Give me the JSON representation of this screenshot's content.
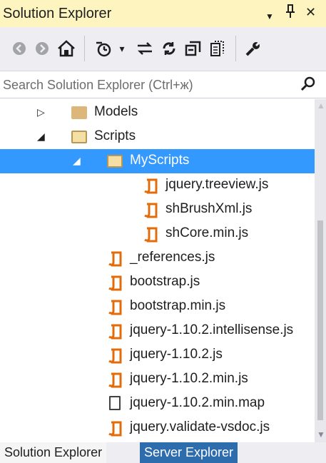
{
  "window": {
    "title": "Solution Explorer",
    "dropdown_glyph": "▼",
    "pin_glyph": "ᵖ",
    "close_glyph": "✕"
  },
  "toolbar": {
    "items": [
      {
        "name": "back-button",
        "icon": "back-circle-icon",
        "glyph": "◐",
        "disabled": true
      },
      {
        "name": "forward-button",
        "icon": "forward-circle-icon",
        "glyph": "◑",
        "disabled": true
      },
      {
        "name": "home-button",
        "icon": "home-icon",
        "glyph": "⌂",
        "disabled": false
      },
      {
        "name": "sync-button",
        "icon": "sync-icon",
        "glyph": "⍉",
        "disabled": false
      },
      {
        "name": "sync-dropdown-button",
        "icon": "dropdown-icon",
        "glyph": "▾",
        "disabled": false
      },
      {
        "name": "pending-changes-button",
        "icon": "arrows-icon",
        "glyph": "⇄",
        "disabled": false
      },
      {
        "name": "refresh-button",
        "icon": "refresh-icon",
        "glyph": "↻",
        "disabled": false
      },
      {
        "name": "collapse-all-button",
        "icon": "collapse-icon",
        "glyph": "⧉",
        "disabled": false
      },
      {
        "name": "show-all-files-button",
        "icon": "show-files-icon",
        "glyph": "▤",
        "disabled": false
      },
      {
        "name": "properties-button",
        "icon": "wrench-icon",
        "glyph": "🔧",
        "disabled": false
      }
    ]
  },
  "search": {
    "placeholder": "Search Solution Explorer (Ctrl+ж)",
    "icon_glyph": "⚲"
  },
  "tree": [
    {
      "label": "Models",
      "type": "folder",
      "depth": 1,
      "expander": "collapsed",
      "selected": false
    },
    {
      "label": "Scripts",
      "type": "folder-open",
      "depth": 1,
      "expander": "expanded",
      "selected": false
    },
    {
      "label": "MyScripts",
      "type": "folder-open",
      "depth": 2,
      "expander": "expanded",
      "selected": true
    },
    {
      "label": "jquery.treeview.js",
      "type": "js",
      "depth": 3,
      "expander": "none",
      "selected": false
    },
    {
      "label": "shBrushXml.js",
      "type": "js",
      "depth": 3,
      "expander": "none",
      "selected": false
    },
    {
      "label": "shCore.min.js",
      "type": "js",
      "depth": 3,
      "expander": "none",
      "selected": false
    },
    {
      "label": "_references.js",
      "type": "js",
      "depth": 2,
      "expander": "none",
      "selected": false
    },
    {
      "label": "bootstrap.js",
      "type": "js",
      "depth": 2,
      "expander": "none",
      "selected": false
    },
    {
      "label": "bootstrap.min.js",
      "type": "js",
      "depth": 2,
      "expander": "none",
      "selected": false
    },
    {
      "label": "jquery-1.10.2.intellisense.js",
      "type": "js",
      "depth": 2,
      "expander": "none",
      "selected": false
    },
    {
      "label": "jquery-1.10.2.js",
      "type": "js",
      "depth": 2,
      "expander": "none",
      "selected": false
    },
    {
      "label": "jquery-1.10.2.min.js",
      "type": "js",
      "depth": 2,
      "expander": "none",
      "selected": false
    },
    {
      "label": "jquery-1.10.2.min.map",
      "type": "file",
      "depth": 2,
      "expander": "none",
      "selected": false
    },
    {
      "label": "jquery.validate-vsdoc.js",
      "type": "js",
      "depth": 2,
      "expander": "none",
      "selected": false
    }
  ],
  "bottom_tabs": {
    "active": "Solution Explorer",
    "inactive": "Server Explorer"
  },
  "colors": {
    "title_bar": "#fdf4bf",
    "selection": "#3399ff",
    "js_icon": "#e36c0a",
    "inactive_tab": "#2d6cad"
  }
}
